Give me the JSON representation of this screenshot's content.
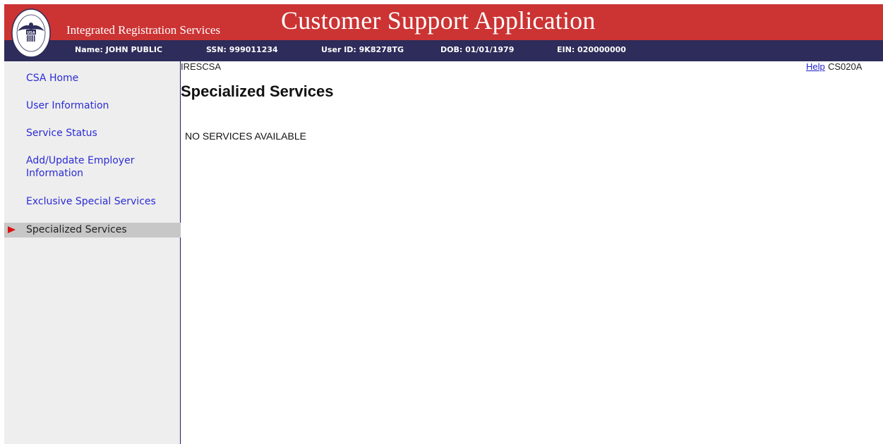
{
  "header": {
    "subtitle": "Integrated Registration Services",
    "app_title": "Customer Support Application",
    "colors": {
      "red_bar": "#cc3333",
      "navy_bar": "#2d2c5a"
    },
    "logo": {
      "icon": "ssa-seal-icon",
      "top_text": "SOCIAL SECURITY",
      "bottom_text": "ADMINISTRATION",
      "center_text": "USA"
    }
  },
  "user_info": {
    "name": "Name: JOHN PUBLIC",
    "ssn": "SSN: 999011234",
    "user_id": "User ID: 9K8278TG",
    "dob": "DOB: 01/01/1979",
    "ein": "EIN: 020000000"
  },
  "sidebar": {
    "items": [
      {
        "label": "CSA Home"
      },
      {
        "label": "User Information"
      },
      {
        "label": "Service Status"
      },
      {
        "label": "Add/Update Employer Information"
      },
      {
        "label": "Exclusive Special Services"
      },
      {
        "label": "Specialized Services",
        "active": true
      }
    ]
  },
  "main": {
    "page_code": "IRESCSA",
    "heading": "Specialized Services",
    "message": "NO SERVICES AVAILABLE",
    "help_label": "Help",
    "screen_id": "CS020A"
  }
}
